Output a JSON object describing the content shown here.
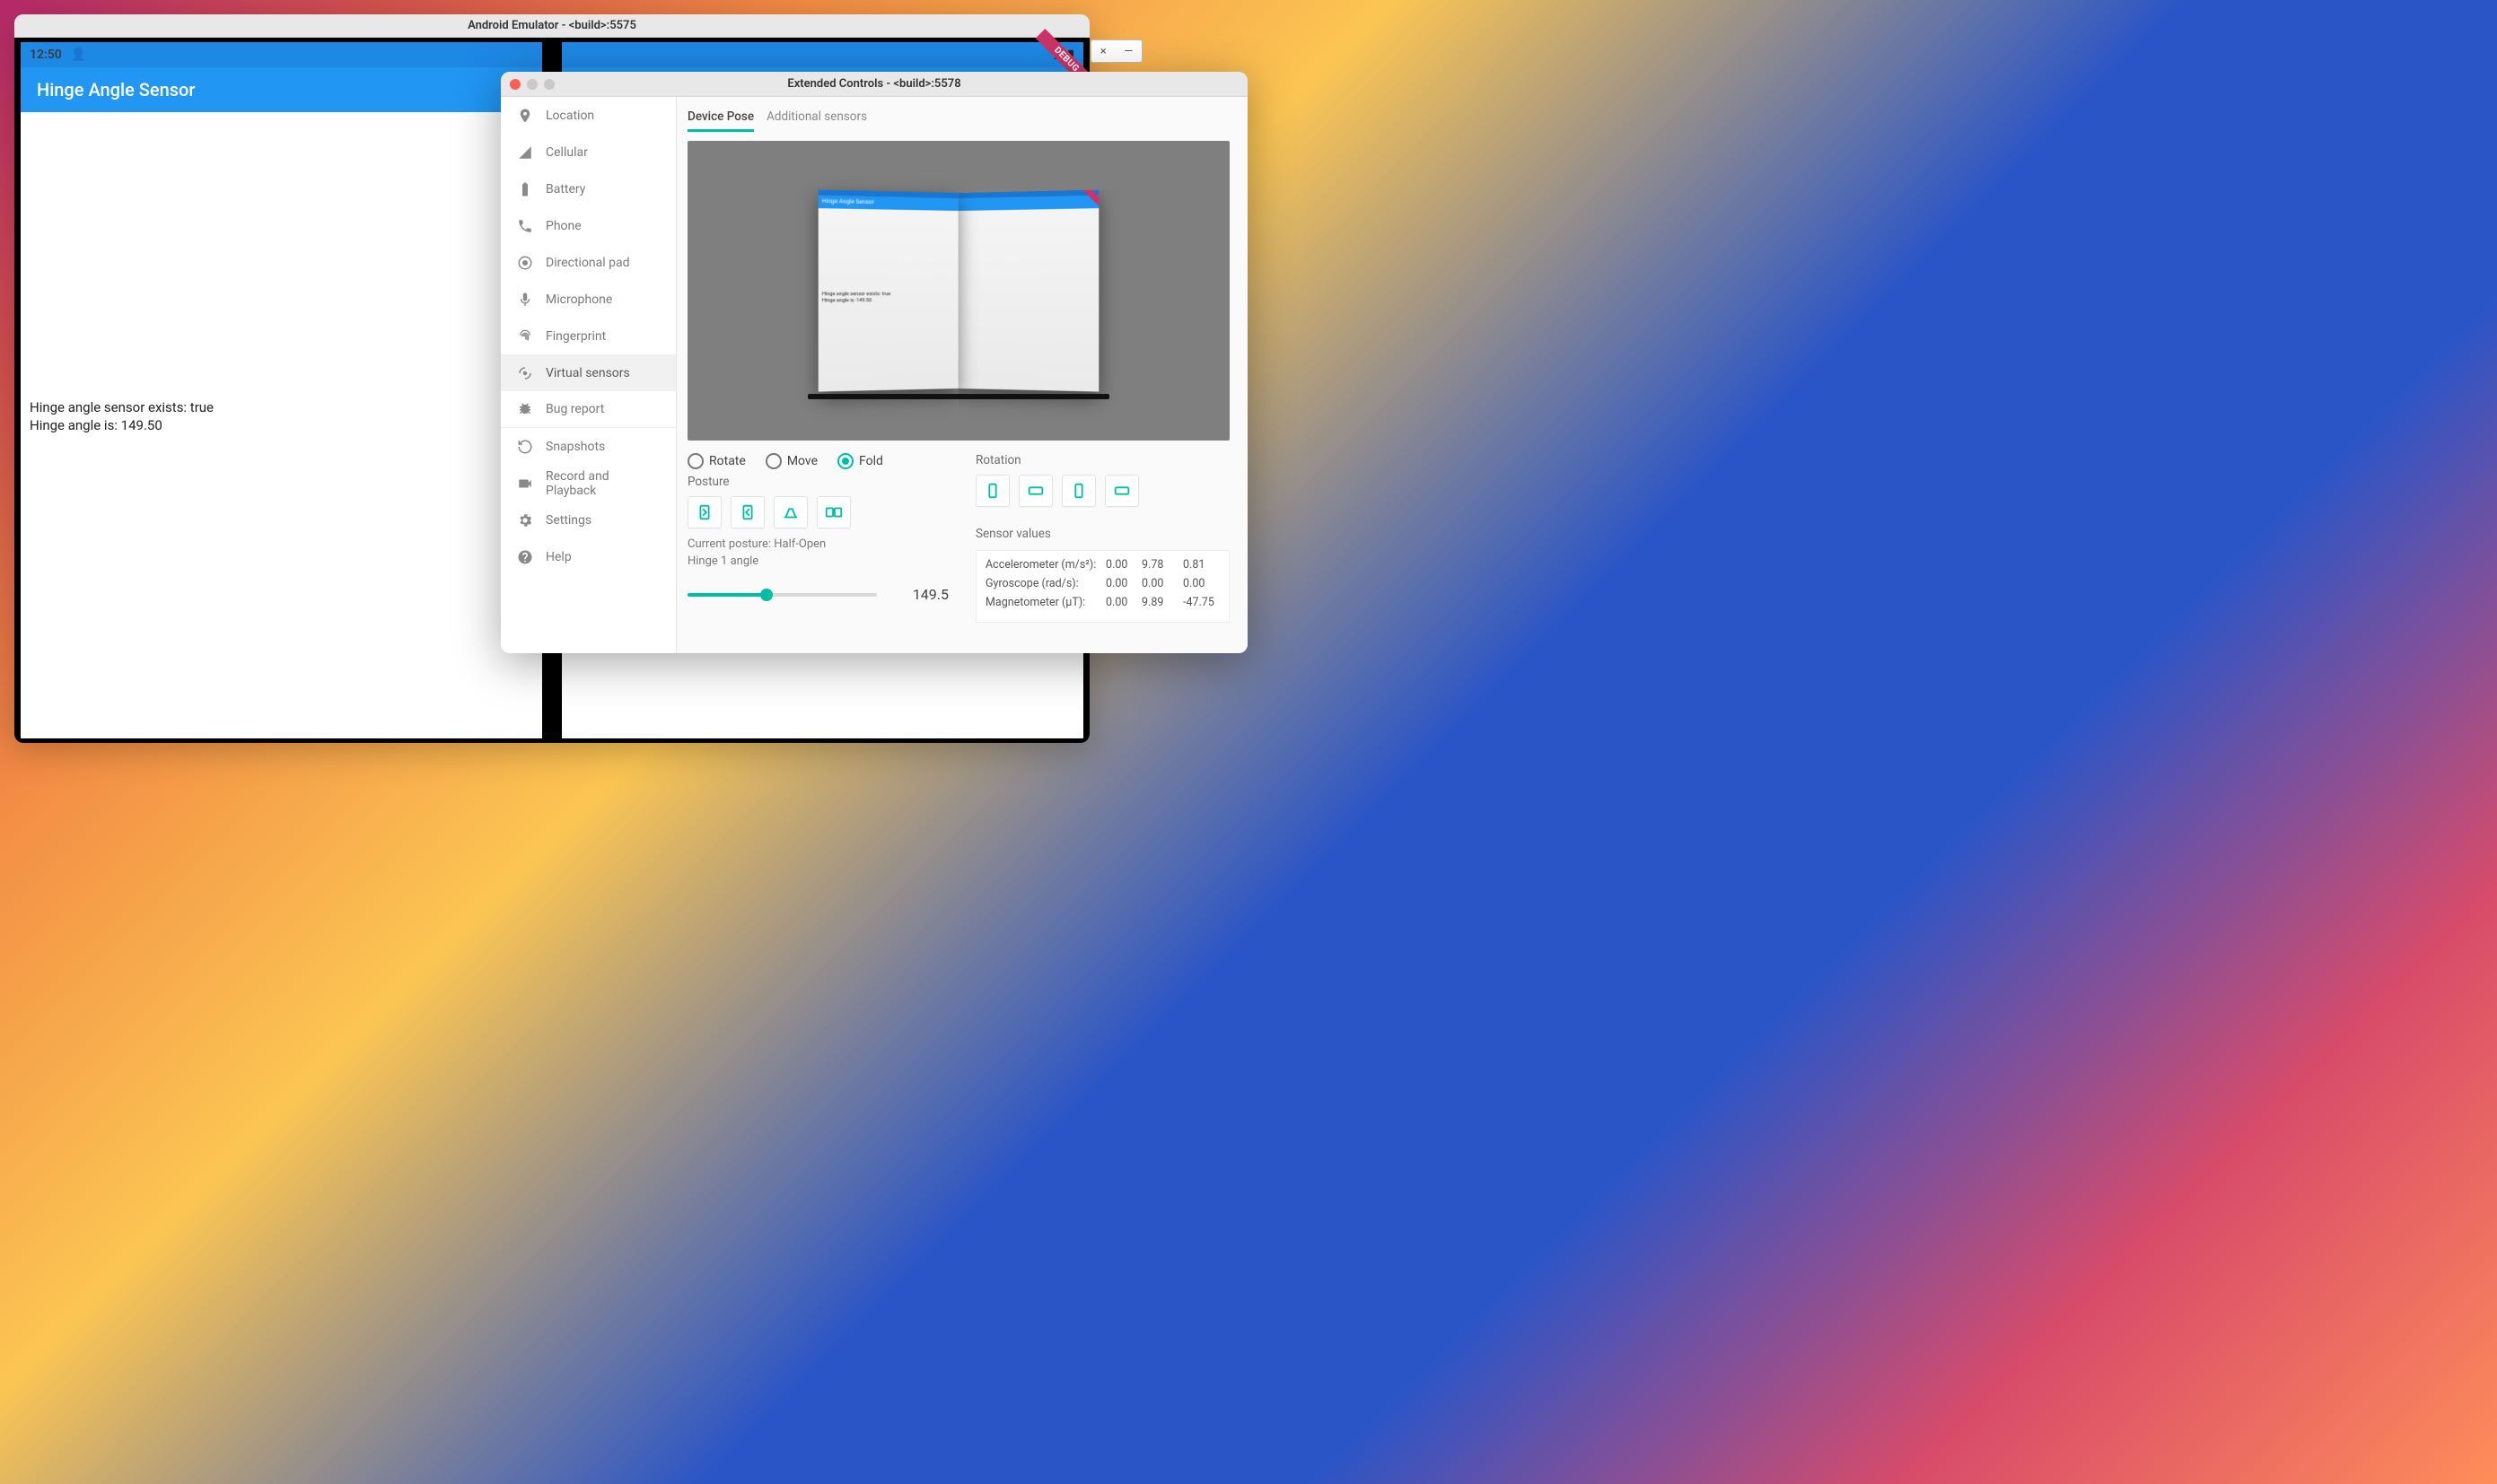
{
  "emulator": {
    "title": "Android Emulator - <build>:5575",
    "status_time": "12:50",
    "app_title": "Hinge Angle Sensor",
    "content_line1": "Hinge angle sensor exists: true",
    "content_line2": "Hinge angle is: 149.50",
    "debug_ribbon": "DEBUG"
  },
  "mini_window": {
    "close": "×",
    "minimize": "—"
  },
  "ext": {
    "title": "Extended Controls - <build>:5578",
    "sidebar": [
      {
        "id": "location",
        "label": "Location"
      },
      {
        "id": "cellular",
        "label": "Cellular"
      },
      {
        "id": "battery",
        "label": "Battery"
      },
      {
        "id": "phone",
        "label": "Phone"
      },
      {
        "id": "dpad",
        "label": "Directional pad"
      },
      {
        "id": "microphone",
        "label": "Microphone"
      },
      {
        "id": "fingerprint",
        "label": "Fingerprint"
      },
      {
        "id": "virtual-sensors",
        "label": "Virtual sensors"
      },
      {
        "id": "bug-report",
        "label": "Bug report"
      },
      {
        "id": "snapshots",
        "label": "Snapshots"
      },
      {
        "id": "record",
        "label": "Record and Playback"
      },
      {
        "id": "settings",
        "label": "Settings"
      },
      {
        "id": "help",
        "label": "Help"
      }
    ],
    "tabs": {
      "device_pose": "Device Pose",
      "additional": "Additional sensors"
    },
    "preview": {
      "app_title": "Hinge Angle Sensor",
      "line1": "Hinge angle sensor exists: true",
      "line2": "Hinge angle is: 149.50"
    },
    "radios": {
      "rotate": "Rotate",
      "move": "Move",
      "fold": "Fold"
    },
    "posture_label": "Posture",
    "current_posture_label": "Current posture: Half-Open",
    "hinge_label": "Hinge 1 angle",
    "hinge_value": "149.5",
    "slider_percent": 41.5,
    "rotation_label": "Rotation",
    "sensor_values_label": "Sensor values",
    "sensors": {
      "accel": {
        "label": "Accelerometer (m/s²):",
        "x": "0.00",
        "y": "9.78",
        "z": "0.81"
      },
      "gyro": {
        "label": "Gyroscope (rad/s):",
        "x": "0.00",
        "y": "0.00",
        "z": "0.00"
      },
      "mag": {
        "label": "Magnetometer (μT):",
        "x": "0.00",
        "y": "9.89",
        "z": "-47.75"
      }
    }
  }
}
